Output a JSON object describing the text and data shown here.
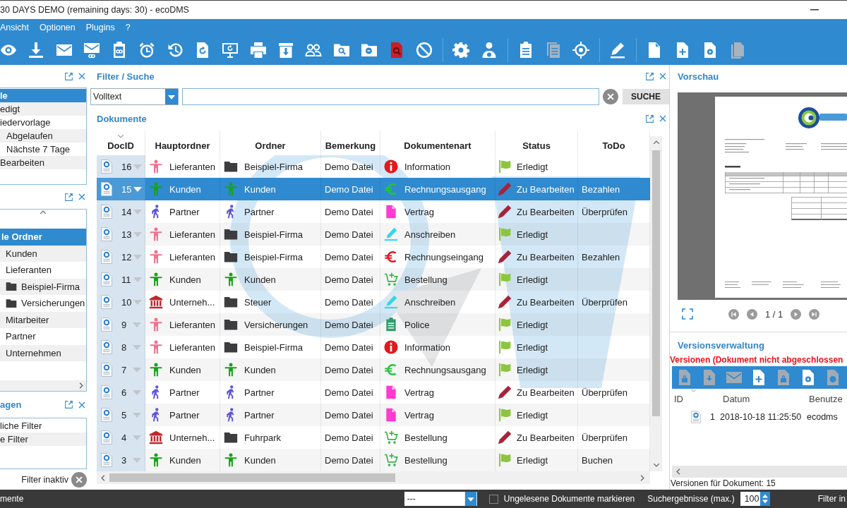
{
  "window": {
    "title": "30 DAYS DEMO (remaining days: 30) - ecoDMS"
  },
  "menu": [
    "Ansicht",
    "Optionen",
    "Plugins",
    "?"
  ],
  "toolbar": [
    [
      {
        "kind": "eye",
        "disabled": false
      },
      {
        "kind": "download",
        "disabled": false
      },
      {
        "kind": "envelope",
        "disabled": false
      },
      {
        "kind": "envelope-link",
        "disabled": false
      },
      {
        "kind": "clipboard-link",
        "disabled": false
      },
      {
        "kind": "alarm",
        "disabled": false
      },
      {
        "kind": "history",
        "disabled": false
      },
      {
        "kind": "doc-refresh",
        "disabled": false
      },
      {
        "kind": "monitor-sync",
        "disabled": false
      },
      {
        "kind": "printer",
        "disabled": false
      },
      {
        "kind": "archive-down",
        "disabled": false
      },
      {
        "kind": "users",
        "disabled": false
      },
      {
        "kind": "folder-search",
        "disabled": false
      },
      {
        "kind": "folder-zoom-out",
        "disabled": false
      },
      {
        "kind": "doc-search",
        "disabled": false
      },
      {
        "kind": "forbidden",
        "disabled": false
      }
    ],
    [
      {
        "kind": "gear",
        "disabled": false
      },
      {
        "kind": "user-gear",
        "disabled": false
      }
    ],
    [
      {
        "kind": "clipboard",
        "disabled": false
      },
      {
        "kind": "clipboard-stack",
        "disabled": true
      },
      {
        "kind": "target",
        "disabled": false
      }
    ],
    [
      {
        "kind": "pen",
        "disabled": false
      }
    ],
    [
      {
        "kind": "doc",
        "disabled": false
      },
      {
        "kind": "doc-plus",
        "disabled": false
      },
      {
        "kind": "doc-gear",
        "disabled": false
      },
      {
        "kind": "doc-stack",
        "disabled": true
      }
    ]
  ],
  "status_panel": {
    "items": [
      {
        "label": "le",
        "selected": true
      },
      {
        "label": "edigt",
        "selected": false
      },
      {
        "label": "iedervorlage",
        "selected": false,
        "children": [
          {
            "label": "Abgelaufen",
            "selected": false
          },
          {
            "label": "Nächste 7 Tage",
            "selected": false
          }
        ]
      },
      {
        "label": "Bearbeiten",
        "selected": false
      }
    ]
  },
  "folder_panel": {
    "tree": [
      {
        "label": "le Ordner",
        "selected": true,
        "children": [
          {
            "label": "Kunden",
            "selected": false
          },
          {
            "label": "Lieferanten",
            "selected": false,
            "children": [
              {
                "label": "Beispiel-Firma",
                "kind": "folder",
                "selected": false
              },
              {
                "label": "Versicherungen",
                "kind": "folder",
                "selected": false
              }
            ]
          },
          {
            "label": "Mitarbeiter",
            "selected": false
          },
          {
            "label": "Partner",
            "selected": false
          },
          {
            "label": "Unternehmen",
            "selected": false
          }
        ]
      }
    ]
  },
  "query_panel": {
    "title": "agen",
    "items": [
      {
        "label": "liche Filter",
        "selected": false
      },
      {
        "label": "e Filter",
        "selected": false
      }
    ]
  },
  "filter_state": "Filter inaktiv",
  "filter": {
    "title": "Filter / Suche",
    "mode": "Volltext",
    "button": "SUCHE"
  },
  "documents": {
    "title": "Dokumente",
    "columns": [
      {
        "label": "DocID",
        "sorted": true
      },
      {
        "label": "Hauptordner",
        "sorted": false
      },
      {
        "label": "Ordner",
        "sorted": false
      },
      {
        "label": "Bemerkung",
        "sorted": false
      },
      {
        "label": "Dokumentenart",
        "sorted": false
      },
      {
        "label": "Status",
        "sorted": false
      },
      {
        "label": "ToDo",
        "sorted": false
      }
    ],
    "rows": [
      {
        "id": "16",
        "main_folder": {
          "kind": "supplier",
          "label": "Lieferanten"
        },
        "folder": {
          "kind": "folder",
          "label": "Beispiel-Firma"
        },
        "remark": "Demo Datei",
        "doc_type": {
          "kind": "info",
          "label": "Information"
        },
        "status": {
          "kind": "done",
          "label": "Erledigt"
        },
        "selected": false
      },
      {
        "id": "15",
        "main_folder": {
          "kind": "customer",
          "label": "Kunden"
        },
        "folder": {
          "kind": "customer",
          "label": "Kunden"
        },
        "remark": "Demo Datei",
        "doc_type": {
          "kind": "euro-out",
          "label": "Rechnungsausgang"
        },
        "status": {
          "kind": "edit",
          "label": "Zu Bearbeiten"
        },
        "todo": "Bezahlen",
        "selected": true
      },
      {
        "id": "14",
        "main_folder": {
          "kind": "partner",
          "label": "Partner"
        },
        "folder": {
          "kind": "partner",
          "label": "Partner"
        },
        "remark": "Demo Datei",
        "doc_type": {
          "kind": "contract",
          "label": "Vertrag"
        },
        "status": {
          "kind": "edit",
          "label": "Zu Bearbeiten"
        },
        "todo": "Überprüfen",
        "selected": false
      },
      {
        "id": "13",
        "main_folder": {
          "kind": "supplier",
          "label": "Lieferanten"
        },
        "folder": {
          "kind": "folder",
          "label": "Beispiel-Firma"
        },
        "remark": "Demo Datei",
        "doc_type": {
          "kind": "letter",
          "label": "Anschreiben"
        },
        "status": {
          "kind": "done",
          "label": "Erledigt"
        },
        "selected": false
      },
      {
        "id": "12",
        "main_folder": {
          "kind": "supplier",
          "label": "Lieferanten"
        },
        "folder": {
          "kind": "folder",
          "label": "Beispiel-Firma"
        },
        "remark": "Demo Datei",
        "doc_type": {
          "kind": "euro-in",
          "label": "Rechnungseingang"
        },
        "status": {
          "kind": "edit",
          "label": "Zu Bearbeiten"
        },
        "todo": "Bezahlen",
        "selected": false
      },
      {
        "id": "11",
        "main_folder": {
          "kind": "customer",
          "label": "Kunden"
        },
        "folder": {
          "kind": "customer",
          "label": "Kunden"
        },
        "remark": "Demo Datei",
        "doc_type": {
          "kind": "order",
          "label": "Bestellung"
        },
        "status": {
          "kind": "done",
          "label": "Erledigt"
        },
        "selected": false
      },
      {
        "id": "10",
        "main_folder": {
          "kind": "company",
          "label": "Unterneh..."
        },
        "folder": {
          "kind": "folder",
          "label": "Steuer"
        },
        "remark": "Demo Datei",
        "doc_type": {
          "kind": "letter",
          "label": "Anschreiben"
        },
        "status": {
          "kind": "edit",
          "label": "Zu Bearbeiten"
        },
        "todo": "Überprüfen",
        "selected": false
      },
      {
        "id": "9",
        "main_folder": {
          "kind": "supplier",
          "label": "Lieferanten"
        },
        "folder": {
          "kind": "folder",
          "label": "Versicherungen"
        },
        "remark": "Demo Datei",
        "doc_type": {
          "kind": "policy",
          "label": "Police"
        },
        "status": {
          "kind": "done",
          "label": "Erledigt"
        },
        "selected": false
      },
      {
        "id": "8",
        "main_folder": {
          "kind": "supplier",
          "label": "Lieferanten"
        },
        "folder": {
          "kind": "folder",
          "label": "Beispiel-Firma"
        },
        "remark": "Demo Datei",
        "doc_type": {
          "kind": "info",
          "label": "Information"
        },
        "status": {
          "kind": "done",
          "label": "Erledigt"
        },
        "selected": false
      },
      {
        "id": "7",
        "main_folder": {
          "kind": "customer",
          "label": "Kunden"
        },
        "folder": {
          "kind": "customer",
          "label": "Kunden"
        },
        "remark": "Demo Datei",
        "doc_type": {
          "kind": "euro-out",
          "label": "Rechnungsausgang"
        },
        "status": {
          "kind": "done",
          "label": "Erledigt"
        },
        "selected": false
      },
      {
        "id": "6",
        "main_folder": {
          "kind": "partner",
          "label": "Partner"
        },
        "folder": {
          "kind": "partner",
          "label": "Partner"
        },
        "remark": "Demo Datei",
        "doc_type": {
          "kind": "contract",
          "label": "Vertrag"
        },
        "status": {
          "kind": "edit",
          "label": "Zu Bearbeiten"
        },
        "todo": "Überprüfen",
        "selected": false
      },
      {
        "id": "5",
        "main_folder": {
          "kind": "partner",
          "label": "Partner"
        },
        "folder": {
          "kind": "partner",
          "label": "Partner"
        },
        "remark": "Demo Datei",
        "doc_type": {
          "kind": "contract",
          "label": "Vertrag"
        },
        "status": {
          "kind": "done",
          "label": "Erledigt"
        },
        "selected": false
      },
      {
        "id": "4",
        "main_folder": {
          "kind": "company",
          "label": "Unterneh..."
        },
        "folder": {
          "kind": "folder",
          "label": "Fuhrpark"
        },
        "remark": "Demo Datei",
        "doc_type": {
          "kind": "order",
          "label": "Bestellung"
        },
        "status": {
          "kind": "edit",
          "label": "Zu Bearbeiten"
        },
        "todo": "Überprüfen",
        "selected": false
      },
      {
        "id": "3",
        "main_folder": {
          "kind": "customer",
          "label": "Kunden"
        },
        "folder": {
          "kind": "customer",
          "label": "Kunden"
        },
        "remark": "Demo Datei",
        "doc_type": {
          "kind": "order",
          "label": "Bestellung"
        },
        "status": {
          "kind": "done",
          "label": "Erledigt"
        },
        "todo": "Buchen",
        "selected": false
      }
    ]
  },
  "preview": {
    "title": "Vorschau",
    "page": "1 / 1"
  },
  "versions": {
    "title": "Versionsverwaltung",
    "warning": "Versionen (Dokument nicht abgeschlossen",
    "toolbar": [
      {
        "kind": "doc-lock",
        "disabled": true
      },
      {
        "kind": "doc-split",
        "disabled": true
      },
      {
        "kind": "envelope",
        "disabled": true
      },
      {
        "kind": "doc-plus",
        "disabled": false
      },
      {
        "kind": "doc-lock",
        "disabled": true
      },
      {
        "kind": "doc-gear",
        "disabled": false
      },
      {
        "kind": "doc-clock",
        "disabled": true
      }
    ],
    "columns": [
      {
        "label": "ID",
        "sorted": true
      },
      {
        "label": "Datum",
        "sorted": false
      },
      {
        "label": "Benutze",
        "sorted": false
      }
    ],
    "rows": [
      {
        "id": "1",
        "date": "2018-10-18 11:25:50",
        "user": "ecodms"
      }
    ],
    "footer": "Versionen für Dokument: 15"
  },
  "status_bar": {
    "label": "mente",
    "dropdown": "---",
    "unread": {
      "label": "Ungelesene Dokumente markieren",
      "checked": false
    },
    "max_label": "Suchergebnisse (max.)",
    "max_results": "100",
    "filter": "Filter in"
  }
}
